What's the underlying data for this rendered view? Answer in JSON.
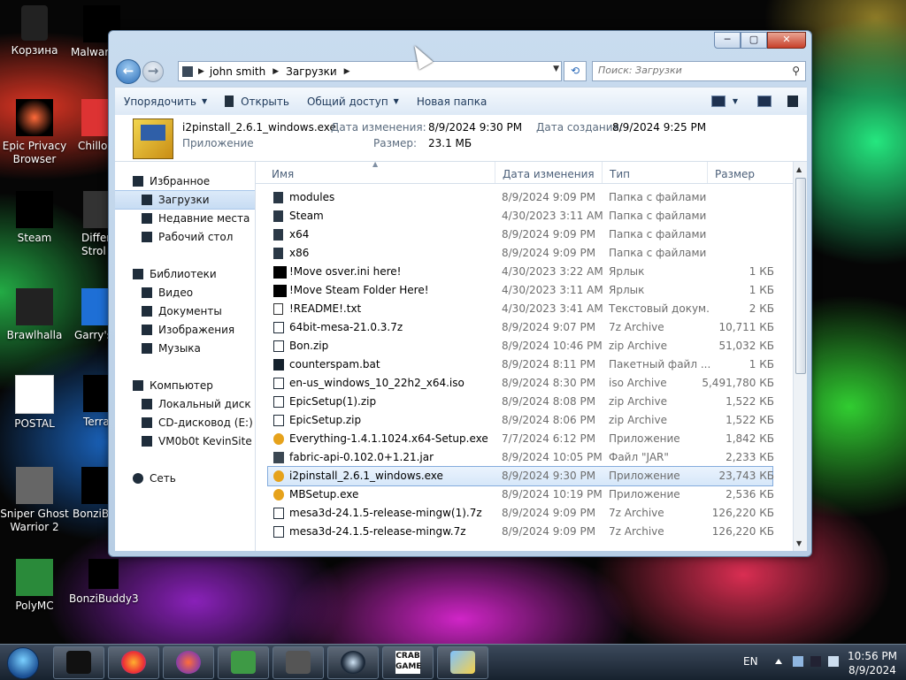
{
  "desktop": {
    "icons": [
      {
        "label": "Корзина"
      },
      {
        "label": "Malwar"
      },
      {
        "label": "Epic Privacy Browser"
      },
      {
        "label": "Chillo"
      },
      {
        "label": "Steam"
      },
      {
        "label": "Differ Strol"
      },
      {
        "label": "Brawlhalla"
      },
      {
        "label": "Garry's"
      },
      {
        "label": "POSTAL"
      },
      {
        "label": "Terra"
      },
      {
        "label": "Sniper Ghost Warrior 2"
      },
      {
        "label": "BonziBu"
      },
      {
        "label": "PolyMC"
      },
      {
        "label": "BonziBuddy3"
      }
    ]
  },
  "window": {
    "controls": {
      "minimize": "─",
      "maximize": "▢",
      "close": "✕"
    },
    "nav": {
      "back": "←",
      "forward": "→"
    },
    "breadcrumb": [
      "john smith",
      "Загрузки"
    ],
    "search_placeholder": "Поиск: Загрузки",
    "toolbar": {
      "organize": "Упорядочить",
      "open": "Открыть",
      "share": "Общий доступ",
      "new_folder": "Новая папка"
    },
    "details": {
      "filename": "i2pinstall_2.6.1_windows.exe",
      "type": "Приложение",
      "modified_label": "Дата изменения:",
      "modified_value": "8/9/2024 9:30 PM",
      "size_label": "Размер:",
      "size_value": "23.1 МБ",
      "created_label": "Дата создания:",
      "created_value": "8/9/2024 9:25 PM"
    },
    "nav_pane": {
      "favorites": "Избранное",
      "downloads": "Загрузки",
      "recent": "Недавние места",
      "desktop": "Рабочий стол",
      "libraries": "Библиотеки",
      "video": "Видео",
      "documents": "Документы",
      "pictures": "Изображения",
      "music": "Музыка",
      "computer": "Компьютер",
      "local_disk": "Локальный диск (C",
      "cd_drive": "CD-дисковод (E:)",
      "vm_share": "VM0b0t KevinSite",
      "network": "Сеть"
    },
    "columns": {
      "name": "Имя",
      "modified": "Дата изменения",
      "type": "Тип",
      "size": "Размер"
    },
    "files": [
      {
        "name": "modules",
        "date": "8/9/2024 9:09 PM",
        "type": "Папка с файлами",
        "size": "",
        "icon": "folder"
      },
      {
        "name": "Steam",
        "date": "4/30/2023 3:11 AM",
        "type": "Папка с файлами",
        "size": "",
        "icon": "folder"
      },
      {
        "name": "x64",
        "date": "8/9/2024 9:09 PM",
        "type": "Папка с файлами",
        "size": "",
        "icon": "folder"
      },
      {
        "name": "x86",
        "date": "8/9/2024 9:09 PM",
        "type": "Папка с файлами",
        "size": "",
        "icon": "folder"
      },
      {
        "name": "!Move osver.ini here!",
        "date": "4/30/2023 3:22 AM",
        "type": "Ярлык",
        "size": "1 КБ",
        "icon": "lnk"
      },
      {
        "name": "!Move Steam Folder Here!",
        "date": "4/30/2023 3:11 AM",
        "type": "Ярлык",
        "size": "1 КБ",
        "icon": "lnk"
      },
      {
        "name": "!README!.txt",
        "date": "4/30/2023 3:41 AM",
        "type": "Текстовый докум...",
        "size": "2 КБ",
        "icon": "txt"
      },
      {
        "name": "64bit-mesa-21.0.3.7z",
        "date": "8/9/2024 9:07 PM",
        "type": "7z Archive",
        "size": "10,711 КБ",
        "icon": "arch"
      },
      {
        "name": "Bon.zip",
        "date": "8/9/2024 10:46 PM",
        "type": "zip Archive",
        "size": "51,032 КБ",
        "icon": "arch"
      },
      {
        "name": "counterspam.bat",
        "date": "8/9/2024 8:11 PM",
        "type": "Пакетный файл ...",
        "size": "1 КБ",
        "icon": "bat"
      },
      {
        "name": "en-us_windows_10_22h2_x64.iso",
        "date": "8/9/2024 8:30 PM",
        "type": "iso Archive",
        "size": "5,491,780 КБ",
        "icon": "arch"
      },
      {
        "name": "EpicSetup(1).zip",
        "date": "8/9/2024 8:08 PM",
        "type": "zip Archive",
        "size": "1,522 КБ",
        "icon": "arch"
      },
      {
        "name": "EpicSetup.zip",
        "date": "8/9/2024 8:06 PM",
        "type": "zip Archive",
        "size": "1,522 КБ",
        "icon": "arch"
      },
      {
        "name": "Everything-1.4.1.1024.x64-Setup.exe",
        "date": "7/7/2024 6:12 PM",
        "type": "Приложение",
        "size": "1,842 КБ",
        "icon": "exe"
      },
      {
        "name": "fabric-api-0.102.0+1.21.jar",
        "date": "8/9/2024 10:05 PM",
        "type": "Файл \"JAR\"",
        "size": "2,233 КБ",
        "icon": "jar"
      },
      {
        "name": "i2pinstall_2.6.1_windows.exe",
        "date": "8/9/2024 9:30 PM",
        "type": "Приложение",
        "size": "23,743 КБ",
        "icon": "exe",
        "selected": true
      },
      {
        "name": "MBSetup.exe",
        "date": "8/9/2024 10:19 PM",
        "type": "Приложение",
        "size": "2,536 КБ",
        "icon": "exe"
      },
      {
        "name": "mesa3d-24.1.5-release-mingw(1).7z",
        "date": "8/9/2024 9:09 PM",
        "type": "7z Archive",
        "size": "126,220 КБ",
        "icon": "arch"
      },
      {
        "name": "mesa3d-24.1.5-release-mingw.7z",
        "date": "8/9/2024 9:09 PM",
        "type": "7z Archive",
        "size": "126,220 КБ",
        "icon": "arch"
      }
    ]
  },
  "taskbar": {
    "apps": [
      {
        "name": "app-1"
      },
      {
        "name": "firefox"
      },
      {
        "name": "epic-privacy"
      },
      {
        "name": "polymc"
      },
      {
        "name": "sniper-ghost"
      },
      {
        "name": "steam"
      },
      {
        "name": "crab-game",
        "text": "CRAB GAME"
      },
      {
        "name": "settings"
      }
    ],
    "lang": "EN",
    "time": "10:56 PM",
    "date": "8/9/2024"
  },
  "colors": {
    "accent": "#3a78c3",
    "selection": "#d6e7f9"
  }
}
